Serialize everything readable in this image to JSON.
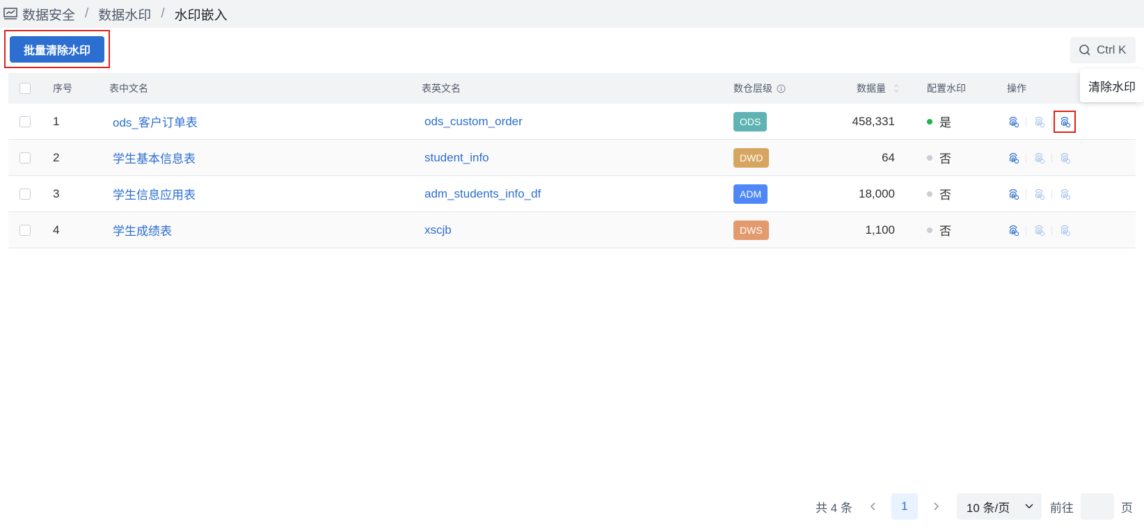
{
  "breadcrumb": [
    "数据安全",
    "数据水印",
    "水印嵌入"
  ],
  "toolbar": {
    "batch_clear_label": "批量清除水印",
    "search_shortcut": "Ctrl K"
  },
  "tooltip": "清除水印",
  "table": {
    "columns": {
      "index": "序号",
      "cn_name": "表中文名",
      "en_name": "表英文名",
      "layer": "数仓层级",
      "volume": "数据量",
      "watermark": "配置水印",
      "ops": "操作"
    },
    "rows": [
      {
        "index": "1",
        "cn_name": "ods_客户订单表",
        "en_name": "ods_custom_order",
        "layer": "ODS",
        "layer_color": "#5fb3b3",
        "volume": "458,331",
        "watermark": "是",
        "watermark_color": "#1fb34a"
      },
      {
        "index": "2",
        "cn_name": "学生基本信息表",
        "en_name": "student_info",
        "layer": "DWD",
        "layer_color": "#d6a55f",
        "volume": "64",
        "watermark": "否",
        "watermark_color": "#c9cdd4"
      },
      {
        "index": "3",
        "cn_name": "学生信息应用表",
        "en_name": "adm_students_info_df",
        "layer": "ADM",
        "layer_color": "#4f87f7",
        "volume": "18,000",
        "watermark": "否",
        "watermark_color": "#c9cdd4"
      },
      {
        "index": "4",
        "cn_name": "学生成绩表",
        "en_name": "xscjb",
        "layer": "DWS",
        "layer_color": "#e39a6d",
        "volume": "1,100",
        "watermark": "否",
        "watermark_color": "#c9cdd4"
      }
    ]
  },
  "pagination": {
    "total": "共 4 条",
    "current_page": "1",
    "page_size": "10 条/页",
    "goto_label": "前往",
    "page_suffix": "页"
  }
}
